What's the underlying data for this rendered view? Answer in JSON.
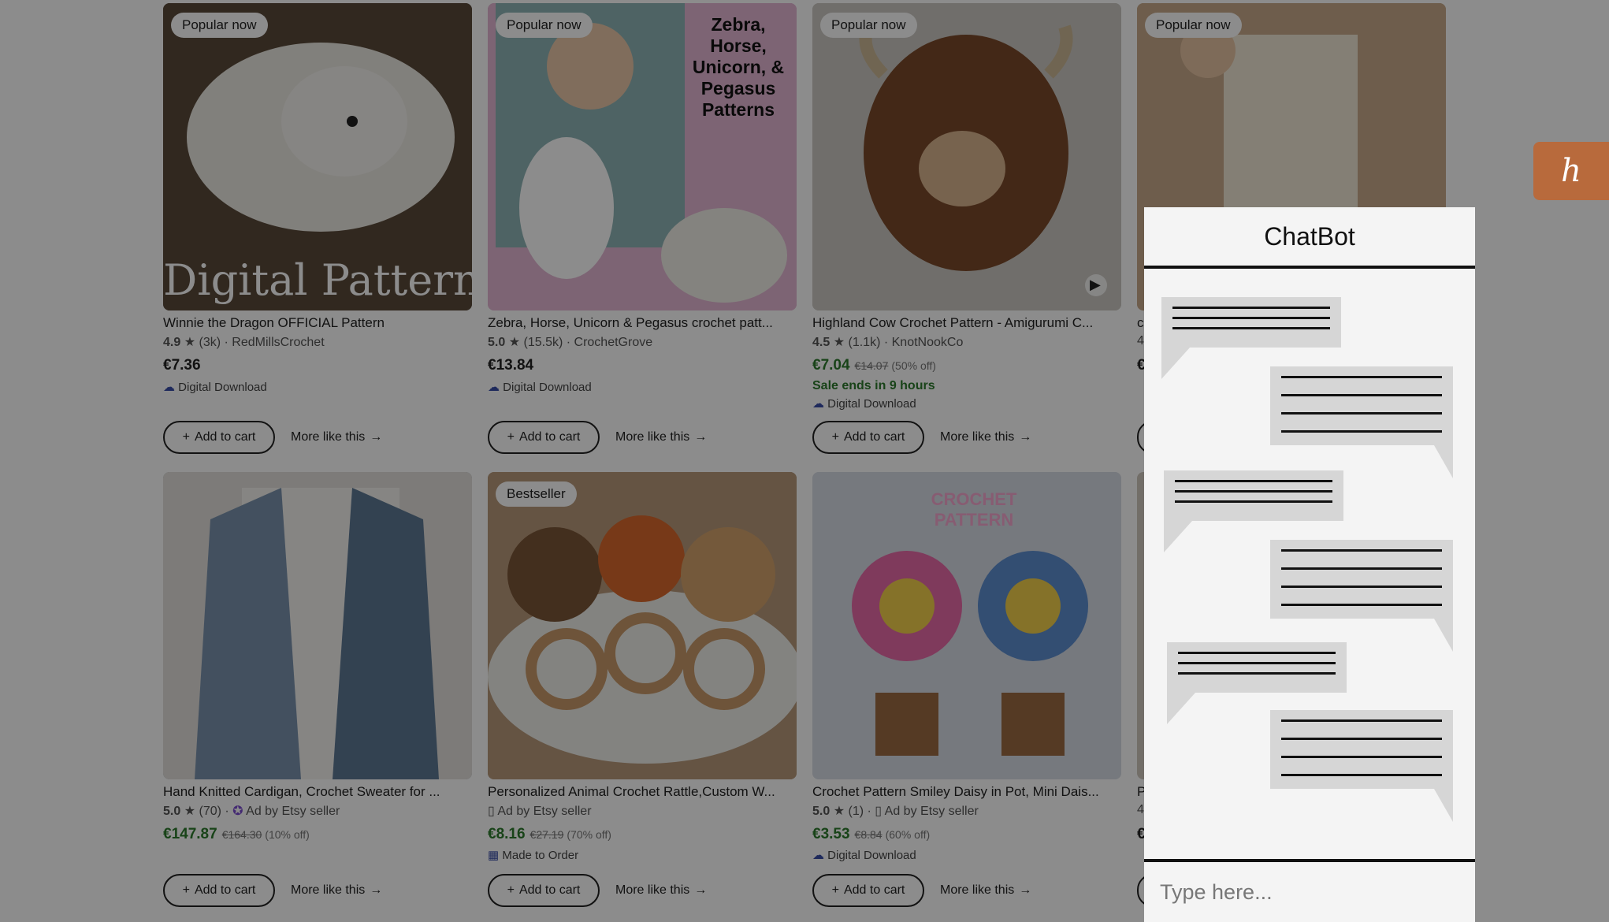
{
  "products": [
    {
      "badge": "Popular now",
      "title": "Winnie the Dragon OFFICIAL Pattern",
      "rating": "4.9",
      "reviews": "(3k)",
      "seller": "RedMillsCrochet",
      "price": "€7.36",
      "orig_price": "",
      "discount": "",
      "sale_ends": "",
      "tag": "Digital Download",
      "add": "Add to cart",
      "more": "More like this",
      "thumb_text": "Digital Pattern",
      "thumb_color": "#8a8276"
    },
    {
      "badge": "Popular now",
      "title": "Zebra, Horse, Unicorn & Pegasus crochet patt...",
      "rating": "5.0",
      "reviews": "(15.5k)",
      "seller": "CrochetGrove",
      "price": "€13.84",
      "orig_price": "",
      "discount": "",
      "sale_ends": "",
      "tag": "Digital Download",
      "add": "Add to cart",
      "more": "More like this",
      "thumb_text": "Zebra, Horse, Unicorn, & Pegasus Patterns",
      "thumb_color": "#d9a7c9"
    },
    {
      "badge": "Popular now",
      "title": "Highland Cow Crochet Pattern - Amigurumi C...",
      "rating": "4.5",
      "reviews": "(1.1k)",
      "seller": "KnotNookCo",
      "price": "€7.04",
      "orig_price": "€14.07",
      "discount": "(50% off)",
      "sale_ends": "Sale ends in 9 hours",
      "tag": "Digital Download",
      "add": "Add to cart",
      "more": "More like this",
      "thumb_text": "",
      "thumb_color": "#c9c5bf"
    },
    {
      "badge": "Popular now",
      "title": "c",
      "rating": "4",
      "reviews": "",
      "seller": "",
      "price": "€",
      "orig_price": "",
      "discount": "",
      "sale_ends": "",
      "tag": "",
      "add": "",
      "more": "",
      "thumb_text": "",
      "thumb_color": "#cbb59a"
    },
    {
      "badge": "",
      "title": "Hand Knitted Cardigan, Crochet Sweater for ...",
      "rating": "5.0",
      "reviews": "(70)",
      "seller": "Ad by Etsy seller",
      "price": "€147.87",
      "orig_price": "€164.30",
      "discount": "(10% off)",
      "sale_ends": "",
      "tag": "",
      "add": "Add to cart",
      "more": "More like this",
      "thumb_text": "",
      "thumb_color": "#9aa7b5"
    },
    {
      "badge": "Bestseller",
      "title": "Personalized Animal Crochet Rattle,Custom W...",
      "rating": "",
      "reviews": "",
      "seller": "Ad by Etsy seller",
      "price": "€8.16",
      "orig_price": "€27.19",
      "discount": "(70% off)",
      "sale_ends": "",
      "tag": "Made to Order",
      "add": "Add to cart",
      "more": "More like this",
      "thumb_text": "",
      "thumb_color": "#b69d86"
    },
    {
      "badge": "",
      "title": "Crochet Pattern Smiley Daisy in Pot, Mini Dais...",
      "rating": "5.0",
      "reviews": "(1)",
      "seller": "Ad by Etsy seller",
      "price": "€3.53",
      "orig_price": "€8.84",
      "discount": "(60% off)",
      "sale_ends": "",
      "tag": "Digital Download",
      "add": "Add to cart",
      "more": "More like this",
      "thumb_text": "CROCHET PATTERN",
      "thumb_color": "#d9dce4"
    },
    {
      "badge": "",
      "title": "P",
      "rating": "4",
      "reviews": "",
      "seller": "",
      "price": "€",
      "orig_price": "",
      "discount": "",
      "sale_ends": "",
      "tag": "",
      "add": "",
      "more": "",
      "thumb_text": "",
      "thumb_color": "#cfc8be"
    }
  ],
  "chat": {
    "title": "ChatBot",
    "placeholder": "Type here..."
  },
  "extension": {
    "icon": "h"
  }
}
